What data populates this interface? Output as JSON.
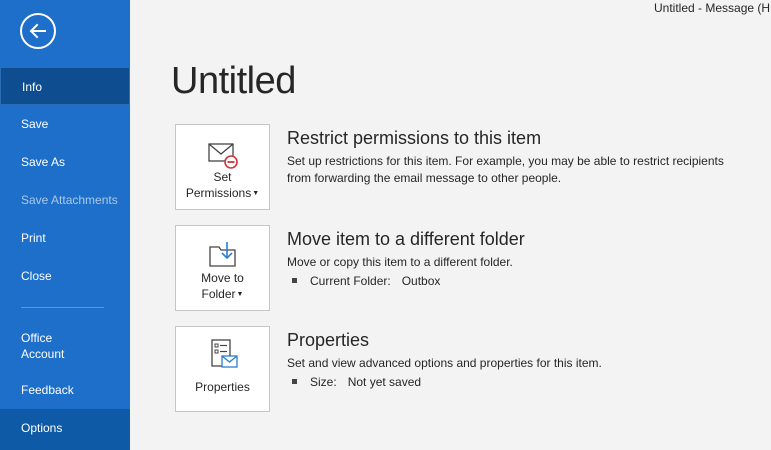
{
  "window": {
    "title": "Untitled  -  Message (H"
  },
  "sidebar": {
    "back_icon": "back-arrow-icon",
    "items": [
      {
        "label": "Info",
        "state": "selected"
      },
      {
        "label": "Save"
      },
      {
        "label": "Save As"
      },
      {
        "label": "Save Attachments",
        "state": "disabled"
      },
      {
        "label": "Print"
      },
      {
        "label": "Close"
      },
      {
        "label": "Office Account",
        "line1": "Office",
        "line2": "Account"
      },
      {
        "label": "Feedback"
      },
      {
        "label": "Options"
      }
    ],
    "colors": {
      "background": "#1e6fc9",
      "selected": "#0e4d8f"
    }
  },
  "main": {
    "title": "Untitled",
    "sections": [
      {
        "button_line1": "Set",
        "button_line2": "Permissions",
        "icon": "envelope-restrict-icon",
        "title": "Restrict permissions to this item",
        "description": "Set up restrictions for this item. For example, you may be able to restrict recipients from forwarding the email message to other people."
      },
      {
        "button_line1": "Move to",
        "button_line2": "Folder",
        "icon": "folder-move-icon",
        "title": "Move item to a different folder",
        "description": "Move or copy this item to a different folder.",
        "bullet_label": "Current Folder:",
        "bullet_value": "Outbox"
      },
      {
        "button_line1": "Properties",
        "icon": "properties-icon",
        "title": "Properties",
        "description": "Set and view advanced options and properties for this item.",
        "bullet_label": "Size:",
        "bullet_value": "Not yet saved"
      }
    ]
  }
}
